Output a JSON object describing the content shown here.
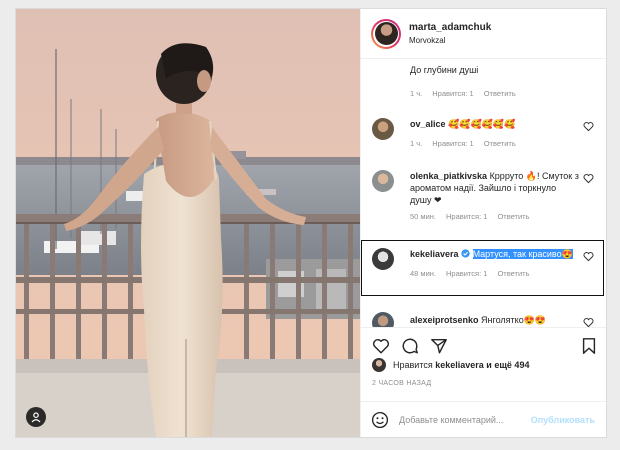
{
  "post": {
    "username": "marta_adamchuk",
    "location": "Morvokzal"
  },
  "comments": [
    {
      "username": "",
      "text": "До глубини душі",
      "time": "1 ч.",
      "likes": "Нравится: 1",
      "reply": "Ответить"
    },
    {
      "username": "ov_alice",
      "text": "🥰🥰🥰🥰🥰🥰",
      "time": "1 ч.",
      "likes": "Нравится: 1",
      "reply": "Ответить"
    },
    {
      "username": "olenka_piatkivska",
      "text": "Кррруто 🔥! Смуток з ароматом надії. Зайшло і торкнуло душу ❤",
      "time": "50 мин.",
      "likes": "Нравится: 1",
      "reply": "Ответить"
    },
    {
      "username": "kekeliavera",
      "text": "Мартуся, так красиво😍",
      "time": "48 мин.",
      "likes": "Нравится: 1",
      "reply": "Ответить"
    },
    {
      "username": "alexeiprotsenko",
      "text": "Янголятко😍😍"
    }
  ],
  "likes_summary": {
    "prefix": "Нравится",
    "user": "kekeliavera",
    "suffix": "и ещё 494"
  },
  "timestamp": "2 ЧАСОВ НАЗАД",
  "add_comment": {
    "placeholder": "Добавьте комментарий...",
    "publish": "Опубликовать"
  },
  "colors": {
    "accent": "#0095f6",
    "publish_disabled": "#b2dffc",
    "selection": "#3390ff",
    "verified": "#3897f0"
  },
  "icons": [
    "like-icon",
    "comment-icon",
    "share-icon",
    "save-icon",
    "emoji-icon",
    "heart-icon",
    "tag-user-icon",
    "verified-icon"
  ]
}
